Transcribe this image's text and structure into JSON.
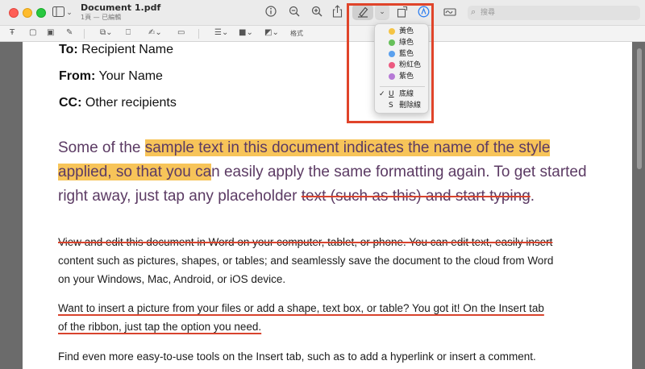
{
  "window": {
    "title": "Document 1.pdf",
    "subtitle": "1頁 — 已編輯"
  },
  "toolbar": {
    "icons": [
      "sidebar-icon",
      "chevron-down-icon",
      "info-icon",
      "zoom-out-icon",
      "zoom-in-icon",
      "share-icon",
      "highlight-pen-icon",
      "chevron-down-icon",
      "rotate-icon",
      "markup-icon",
      "signature-icon"
    ],
    "search_placeholder": "搜尋"
  },
  "markup_toolbar": {
    "format_label": "格式"
  },
  "highlight_menu": {
    "colors": [
      {
        "label": "黃色",
        "color": "#f5c445"
      },
      {
        "label": "綠色",
        "color": "#67c05a"
      },
      {
        "label": "藍色",
        "color": "#5aa0ee"
      },
      {
        "label": "粉紅色",
        "color": "#ec5a80"
      },
      {
        "label": "紫色",
        "color": "#b67ad6"
      }
    ],
    "styles": [
      {
        "glyph": "U",
        "label": "底線",
        "checked": true
      },
      {
        "glyph": "S",
        "label": "刪除線",
        "checked": false
      }
    ],
    "check_mark": "✓"
  },
  "document": {
    "to_label": "To:",
    "to_value": "Recipient Name",
    "from_label": "From:",
    "from_value": "Your Name",
    "cc_label": "CC:",
    "cc_value": "Other recipients",
    "big_line1_a": "Some of the ",
    "big_line1_b": "sample text in this document indicates the name of the style",
    "big_line2_a": "applied, so that you ca",
    "big_line2_b": "n easily apply the same formatting again. To get started",
    "big_line3_a": "right away, just tap any placeholder ",
    "big_line3_b": "text (such as this) and start typing",
    "big_line3_c": ".",
    "para1_line1": "View and edit this document in Word on your computer, tablet, or phone. You can edit text, easily insert",
    "para1_line2": "content such as pictures, shapes, or tables; and seamlessly save the document to the cloud from Word",
    "para1_line3": "on your Windows, Mac, Android, or iOS device.",
    "para2_line1": "Want to insert a picture from your files or add a shape, text box, or table? You got it! On the Insert tab",
    "para2_line2": "of the ribbon, just tap the option you need.",
    "para3_line1": "Find even more easy-to-use tools on the Insert tab, such as to add a hyperlink or insert a comment."
  }
}
